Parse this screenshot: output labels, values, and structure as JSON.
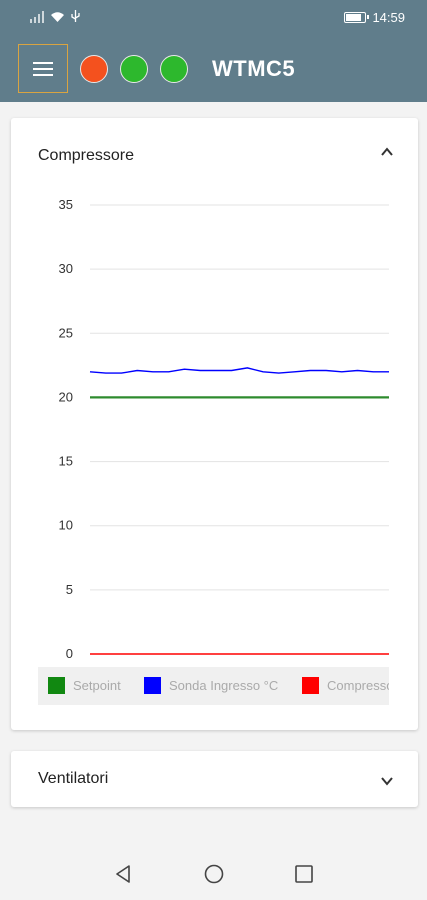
{
  "status_bar": {
    "time": "14:59"
  },
  "header": {
    "title": "WTMC5",
    "leds": [
      {
        "name": "led-red",
        "color": "#f4511e"
      },
      {
        "name": "led-green-1",
        "color": "#2db82d"
      },
      {
        "name": "led-green-2",
        "color": "#2db82d"
      }
    ],
    "bar_color": "#607d8b",
    "menu_icon": "menu-icon"
  },
  "compressore": {
    "title": "Compressore",
    "expanded": true,
    "chart_data": {
      "type": "line",
      "ylim": [
        0,
        35
      ],
      "yticks": [
        "35",
        "30",
        "25",
        "20",
        "15",
        "10",
        "5",
        "0"
      ],
      "grid": true,
      "legend_position": "bottom",
      "series": [
        {
          "name": "Setpoint",
          "color": "#2e8b2e",
          "values": [
            20,
            20,
            20,
            20,
            20,
            20,
            20,
            20,
            20,
            20,
            20,
            20,
            20,
            20,
            20,
            20,
            20,
            20,
            20,
            20
          ]
        },
        {
          "name": "Sonda Ingresso °C",
          "color": "#0000ff",
          "values": [
            22.0,
            21.9,
            21.9,
            22.1,
            22.0,
            22.0,
            22.2,
            22.1,
            22.1,
            22.1,
            22.3,
            22.0,
            21.9,
            22.0,
            22.1,
            22.1,
            22.0,
            22.1,
            22.0,
            22.0
          ]
        },
        {
          "name": "Compressore",
          "color": "#ff0000",
          "values": [
            0,
            0,
            0,
            0,
            0,
            0,
            0,
            0,
            0,
            0,
            0,
            0,
            0,
            0,
            0,
            0,
            0,
            0,
            0,
            0
          ]
        }
      ]
    },
    "legend": [
      {
        "label": "Setpoint",
        "color": "#118811"
      },
      {
        "label": "Sonda Ingresso °C",
        "color": "#0000ff"
      },
      {
        "label": "Compressore",
        "color": "#ff0000"
      }
    ]
  },
  "ventilatori": {
    "title": "Ventilatori",
    "expanded": false
  },
  "nav": {
    "back": "back-icon",
    "home": "home-icon",
    "recents": "recents-icon"
  }
}
